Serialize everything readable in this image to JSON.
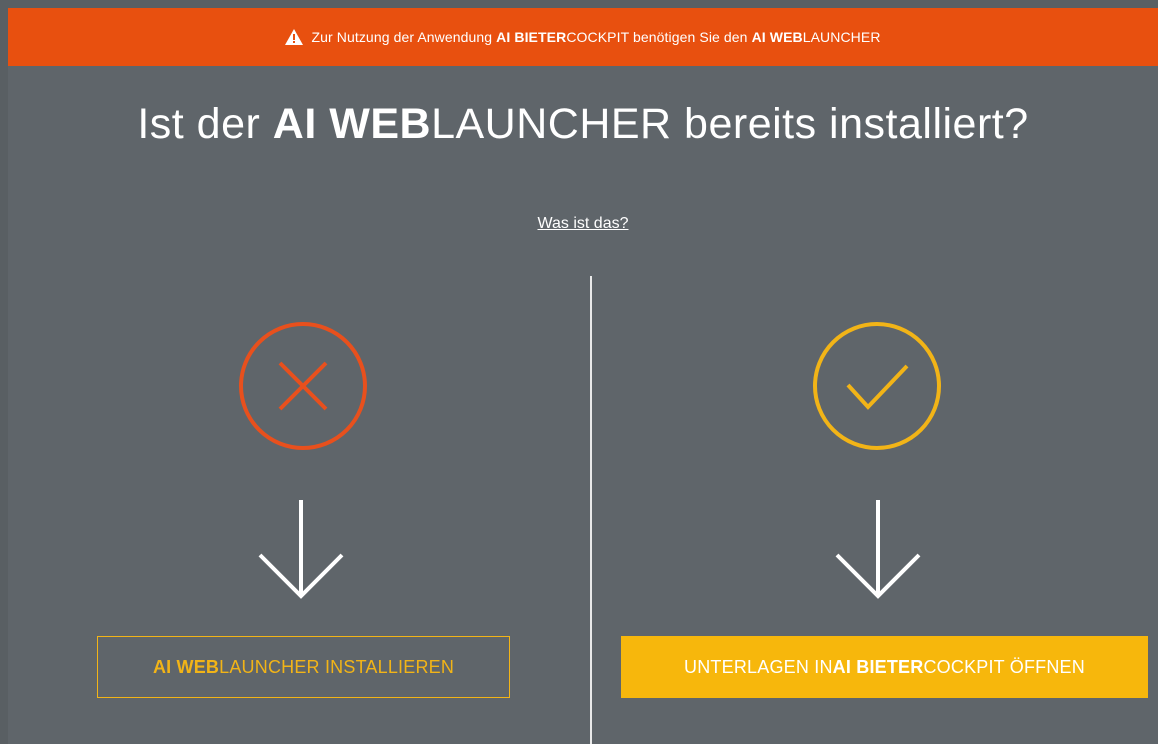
{
  "banner": {
    "text_before": "Zur Nutzung der Anwendung ",
    "app_bold": "AI BIETER",
    "app_rest": "COCKPIT",
    "text_middle": " benötigen Sie den ",
    "launcher_bold": "AI WEB",
    "launcher_rest": "LAUNCHER",
    "icon": "warning-triangle-icon"
  },
  "title": {
    "prefix": "Ist der ",
    "bold": "AI WEB",
    "rest": "LAUNCHER bereits installiert?"
  },
  "help_link": "Was ist das?",
  "left_option": {
    "icon": "x-circle-icon",
    "arrow": "arrow-down-icon",
    "button_bold": "AI WEB",
    "button_rest": "LAUNCHER INSTALLIEREN"
  },
  "right_option": {
    "icon": "check-circle-icon",
    "arrow": "arrow-down-icon",
    "button_prefix": "UNTERLAGEN IN ",
    "button_bold": "AI BIETER",
    "button_rest": "COCKPIT ÖFFNEN"
  },
  "colors": {
    "banner": "#e8500f",
    "background": "#5f656a",
    "x_icon": "#e8501d",
    "check_icon": "#f2b417",
    "install_button": "#f2b417",
    "open_button": "#f7b70c"
  }
}
